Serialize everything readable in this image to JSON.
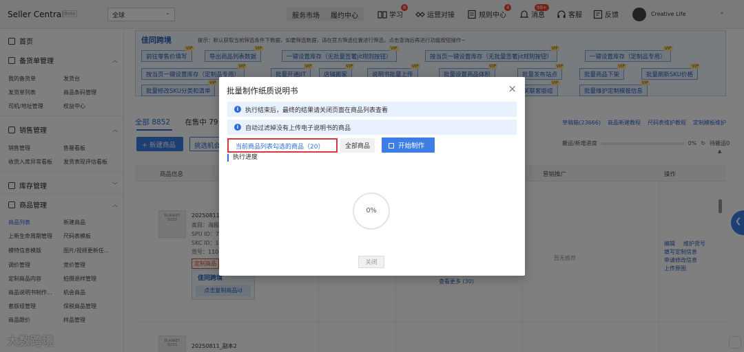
{
  "header": {
    "brand": "Seller Central",
    "beta": "Beta",
    "region": "全球",
    "service_market": "服务市场",
    "fulfillment_center": "履约中心",
    "nav": [
      {
        "label": "学习",
        "badge": "6",
        "icon": "book-icon"
      },
      {
        "label": "运营对接",
        "badge": "",
        "icon": "handshake-icon"
      },
      {
        "label": "规则中心",
        "badge": "4",
        "icon": "rules-icon"
      },
      {
        "label": "消息",
        "badge": "99+",
        "icon": "bell-icon"
      },
      {
        "label": "客服",
        "badge": "",
        "icon": "headset-icon"
      },
      {
        "label": "反馈",
        "badge": "",
        "icon": "feedback-icon"
      }
    ],
    "username": "Creative Life"
  },
  "sidebar": {
    "home": "首页",
    "sections": [
      {
        "title": "备货单管理",
        "items": [
          "我的备货单",
          "发货台",
          "发货单列表",
          "商品条码管理",
          "司机/地址管理",
          "权益中心"
        ]
      },
      {
        "title": "销售管理",
        "items": [
          "销售管理",
          "售罄看板",
          "收货入库异常看板",
          "发货表现评估看板"
        ]
      },
      {
        "title": "库存管理",
        "items": []
      },
      {
        "title": "商品管理",
        "items": [
          "商品列表",
          "新建商品",
          "上新生命周期管理",
          "尺码表模板",
          "模特信息模版",
          "图片/视频更新任...",
          "调价管理",
          "竞价管理",
          "定制商品内容",
          "拍摄退样管理",
          "商品说明书制作...",
          "机会商品",
          "套版组管理",
          "保税商品管理",
          "商品跟价",
          "样品管理"
        ]
      }
    ],
    "active_item": "商品列表"
  },
  "toolbox": {
    "logo": "佳同跨境",
    "tip": "提示：默认获取当前筛选条件下数据，如要筛选数据，请在官方筛选位置进行筛选，点击查询后再进行功能按钮操作~",
    "buttons": [
      "前往零售价填写",
      "导出商品列表数据",
      "一键设置库存（无批量签署jit规则按钮）",
      "按当页一键设置库存（无批量签署jit规则按钮）",
      "一键设置库存（定制品专用）",
      "按当页一键设置库存（定制品专用）",
      "批量开通JIT",
      "店铺搬家",
      "说明书批量上传",
      "批量设置商品体积",
      "批量发布站点",
      "批量商品下架",
      "批量刷新SKU价格",
      "批量修改SKU分类和清单",
      "关联套版组",
      "批量维护定制模板信息"
    ],
    "vip_label": "VIP"
  },
  "tabs": {
    "all": "全部 8852",
    "on_sale": "在售中 79"
  },
  "right_links": [
    "草稿箱(23666)",
    "商品新建教程",
    "尺码表维护教程",
    "定制模板维护"
  ],
  "actions": {
    "new_product": "+ 新建商品",
    "batch": "挑选机会"
  },
  "progress": {
    "label": "搬运/新增进度",
    "value": 0,
    "percent_text": "0%",
    "pending": "待搬运0"
  },
  "table": {
    "headers": [
      "商品信息",
      "营销推广",
      "操作"
    ],
    "row1": {
      "title": "20250811",
      "category_label": "类目：海报",
      "spu": "SPU ID：7",
      "skc": "SKC ID：1",
      "code": "货号：110",
      "tag": "定制商品",
      "copy_logo": "佳同跨境",
      "copy_btn": "点击复制商品id",
      "promo": "暂无推荐",
      "more": "查看更多 (30)",
      "ops": [
        "编辑",
        "维护货号",
        "填写定制信息",
        "申请修改信息",
        "上传原图"
      ]
    },
    "row2": {
      "title": "20250811_副本2"
    },
    "thumb_label": "BLANKET SIZES"
  },
  "watermark": "大数跨境",
  "modal": {
    "title": "批量制作纸质说明书",
    "info1": "执行结束后，最终的结果请关闭页面在商品列表查看",
    "info2": "自动过滤掉没有上传电子说明书的商品",
    "select_current": "当前商品列表勾选的商品（20）",
    "select_all": "全部商品",
    "start": "开始制作",
    "exec_label": "执行进度",
    "percent": 0,
    "percent_text": "0%",
    "close": "关闭"
  }
}
